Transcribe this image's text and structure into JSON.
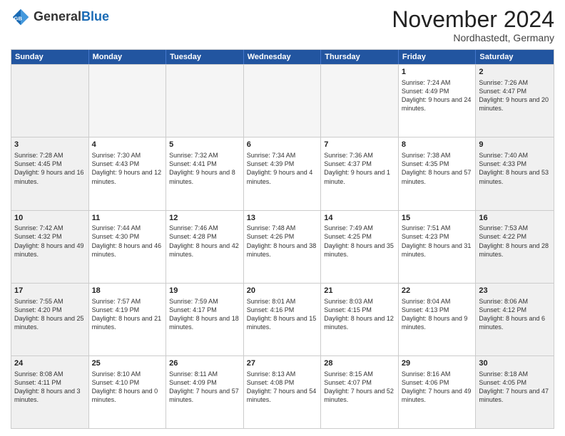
{
  "logo": {
    "general": "General",
    "blue": "Blue"
  },
  "header": {
    "title": "November 2024",
    "subtitle": "Nordhastedt, Germany"
  },
  "days": [
    "Sunday",
    "Monday",
    "Tuesday",
    "Wednesday",
    "Thursday",
    "Friday",
    "Saturday"
  ],
  "weeks": [
    [
      {
        "day": "",
        "content": ""
      },
      {
        "day": "",
        "content": ""
      },
      {
        "day": "",
        "content": ""
      },
      {
        "day": "",
        "content": ""
      },
      {
        "day": "",
        "content": ""
      },
      {
        "day": "1",
        "content": "Sunrise: 7:24 AM\nSunset: 4:49 PM\nDaylight: 9 hours and 24 minutes."
      },
      {
        "day": "2",
        "content": "Sunrise: 7:26 AM\nSunset: 4:47 PM\nDaylight: 9 hours and 20 minutes."
      }
    ],
    [
      {
        "day": "3",
        "content": "Sunrise: 7:28 AM\nSunset: 4:45 PM\nDaylight: 9 hours and 16 minutes."
      },
      {
        "day": "4",
        "content": "Sunrise: 7:30 AM\nSunset: 4:43 PM\nDaylight: 9 hours and 12 minutes."
      },
      {
        "day": "5",
        "content": "Sunrise: 7:32 AM\nSunset: 4:41 PM\nDaylight: 9 hours and 8 minutes."
      },
      {
        "day": "6",
        "content": "Sunrise: 7:34 AM\nSunset: 4:39 PM\nDaylight: 9 hours and 4 minutes."
      },
      {
        "day": "7",
        "content": "Sunrise: 7:36 AM\nSunset: 4:37 PM\nDaylight: 9 hours and 1 minute."
      },
      {
        "day": "8",
        "content": "Sunrise: 7:38 AM\nSunset: 4:35 PM\nDaylight: 8 hours and 57 minutes."
      },
      {
        "day": "9",
        "content": "Sunrise: 7:40 AM\nSunset: 4:33 PM\nDaylight: 8 hours and 53 minutes."
      }
    ],
    [
      {
        "day": "10",
        "content": "Sunrise: 7:42 AM\nSunset: 4:32 PM\nDaylight: 8 hours and 49 minutes."
      },
      {
        "day": "11",
        "content": "Sunrise: 7:44 AM\nSunset: 4:30 PM\nDaylight: 8 hours and 46 minutes."
      },
      {
        "day": "12",
        "content": "Sunrise: 7:46 AM\nSunset: 4:28 PM\nDaylight: 8 hours and 42 minutes."
      },
      {
        "day": "13",
        "content": "Sunrise: 7:48 AM\nSunset: 4:26 PM\nDaylight: 8 hours and 38 minutes."
      },
      {
        "day": "14",
        "content": "Sunrise: 7:49 AM\nSunset: 4:25 PM\nDaylight: 8 hours and 35 minutes."
      },
      {
        "day": "15",
        "content": "Sunrise: 7:51 AM\nSunset: 4:23 PM\nDaylight: 8 hours and 31 minutes."
      },
      {
        "day": "16",
        "content": "Sunrise: 7:53 AM\nSunset: 4:22 PM\nDaylight: 8 hours and 28 minutes."
      }
    ],
    [
      {
        "day": "17",
        "content": "Sunrise: 7:55 AM\nSunset: 4:20 PM\nDaylight: 8 hours and 25 minutes."
      },
      {
        "day": "18",
        "content": "Sunrise: 7:57 AM\nSunset: 4:19 PM\nDaylight: 8 hours and 21 minutes."
      },
      {
        "day": "19",
        "content": "Sunrise: 7:59 AM\nSunset: 4:17 PM\nDaylight: 8 hours and 18 minutes."
      },
      {
        "day": "20",
        "content": "Sunrise: 8:01 AM\nSunset: 4:16 PM\nDaylight: 8 hours and 15 minutes."
      },
      {
        "day": "21",
        "content": "Sunrise: 8:03 AM\nSunset: 4:15 PM\nDaylight: 8 hours and 12 minutes."
      },
      {
        "day": "22",
        "content": "Sunrise: 8:04 AM\nSunset: 4:13 PM\nDaylight: 8 hours and 9 minutes."
      },
      {
        "day": "23",
        "content": "Sunrise: 8:06 AM\nSunset: 4:12 PM\nDaylight: 8 hours and 6 minutes."
      }
    ],
    [
      {
        "day": "24",
        "content": "Sunrise: 8:08 AM\nSunset: 4:11 PM\nDaylight: 8 hours and 3 minutes."
      },
      {
        "day": "25",
        "content": "Sunrise: 8:10 AM\nSunset: 4:10 PM\nDaylight: 8 hours and 0 minutes."
      },
      {
        "day": "26",
        "content": "Sunrise: 8:11 AM\nSunset: 4:09 PM\nDaylight: 7 hours and 57 minutes."
      },
      {
        "day": "27",
        "content": "Sunrise: 8:13 AM\nSunset: 4:08 PM\nDaylight: 7 hours and 54 minutes."
      },
      {
        "day": "28",
        "content": "Sunrise: 8:15 AM\nSunset: 4:07 PM\nDaylight: 7 hours and 52 minutes."
      },
      {
        "day": "29",
        "content": "Sunrise: 8:16 AM\nSunset: 4:06 PM\nDaylight: 7 hours and 49 minutes."
      },
      {
        "day": "30",
        "content": "Sunrise: 8:18 AM\nSunset: 4:05 PM\nDaylight: 7 hours and 47 minutes."
      }
    ]
  ]
}
